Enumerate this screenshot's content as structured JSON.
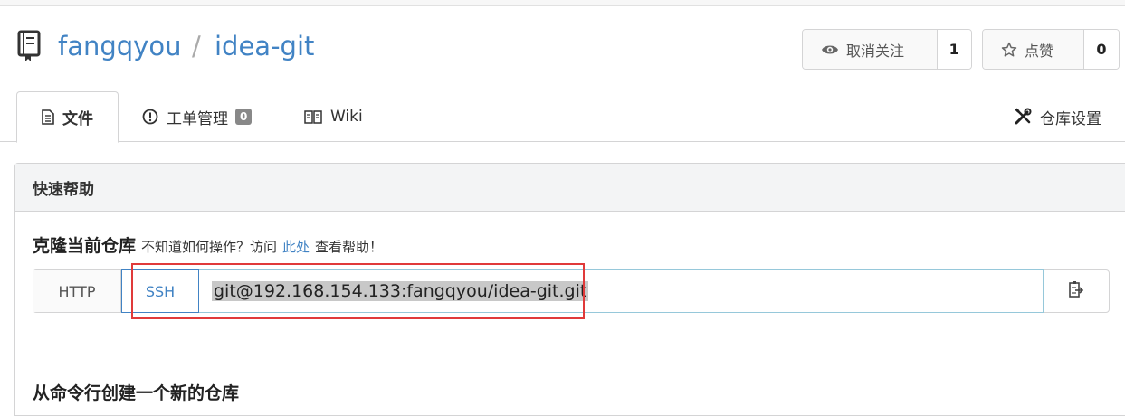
{
  "repo": {
    "owner": "fangqyou",
    "separator": "/",
    "name": "idea-git"
  },
  "watch": {
    "label": "取消关注",
    "count": "1"
  },
  "star": {
    "label": "点赞",
    "count": "0"
  },
  "tabs": {
    "files": "文件",
    "issues": "工单管理",
    "issues_count": "0",
    "wiki": "Wiki",
    "settings": "仓库设置"
  },
  "quick_help": {
    "header": "快速帮助",
    "clone_title": "克隆当前仓库",
    "clone_hint_before": "不知道如何操作？访问",
    "clone_hint_link": "此处",
    "clone_hint_after": "查看帮助！",
    "http_label": "HTTP",
    "ssh_label": "SSH",
    "clone_url": "git@192.168.154.133:fangqyou/idea-git.git",
    "new_repo_title": "从命令行创建一个新的仓库"
  },
  "colors": {
    "link": "#4183c4",
    "highlight_box": "#e03a3a"
  },
  "icons": {
    "repo": "book-icon",
    "watch": "eye-icon",
    "star": "star-outline-icon",
    "files": "file-text-icon",
    "issues": "issue-opened-icon",
    "wiki": "book-open-icon",
    "settings": "tools-icon",
    "copy": "clipboard-icon"
  }
}
